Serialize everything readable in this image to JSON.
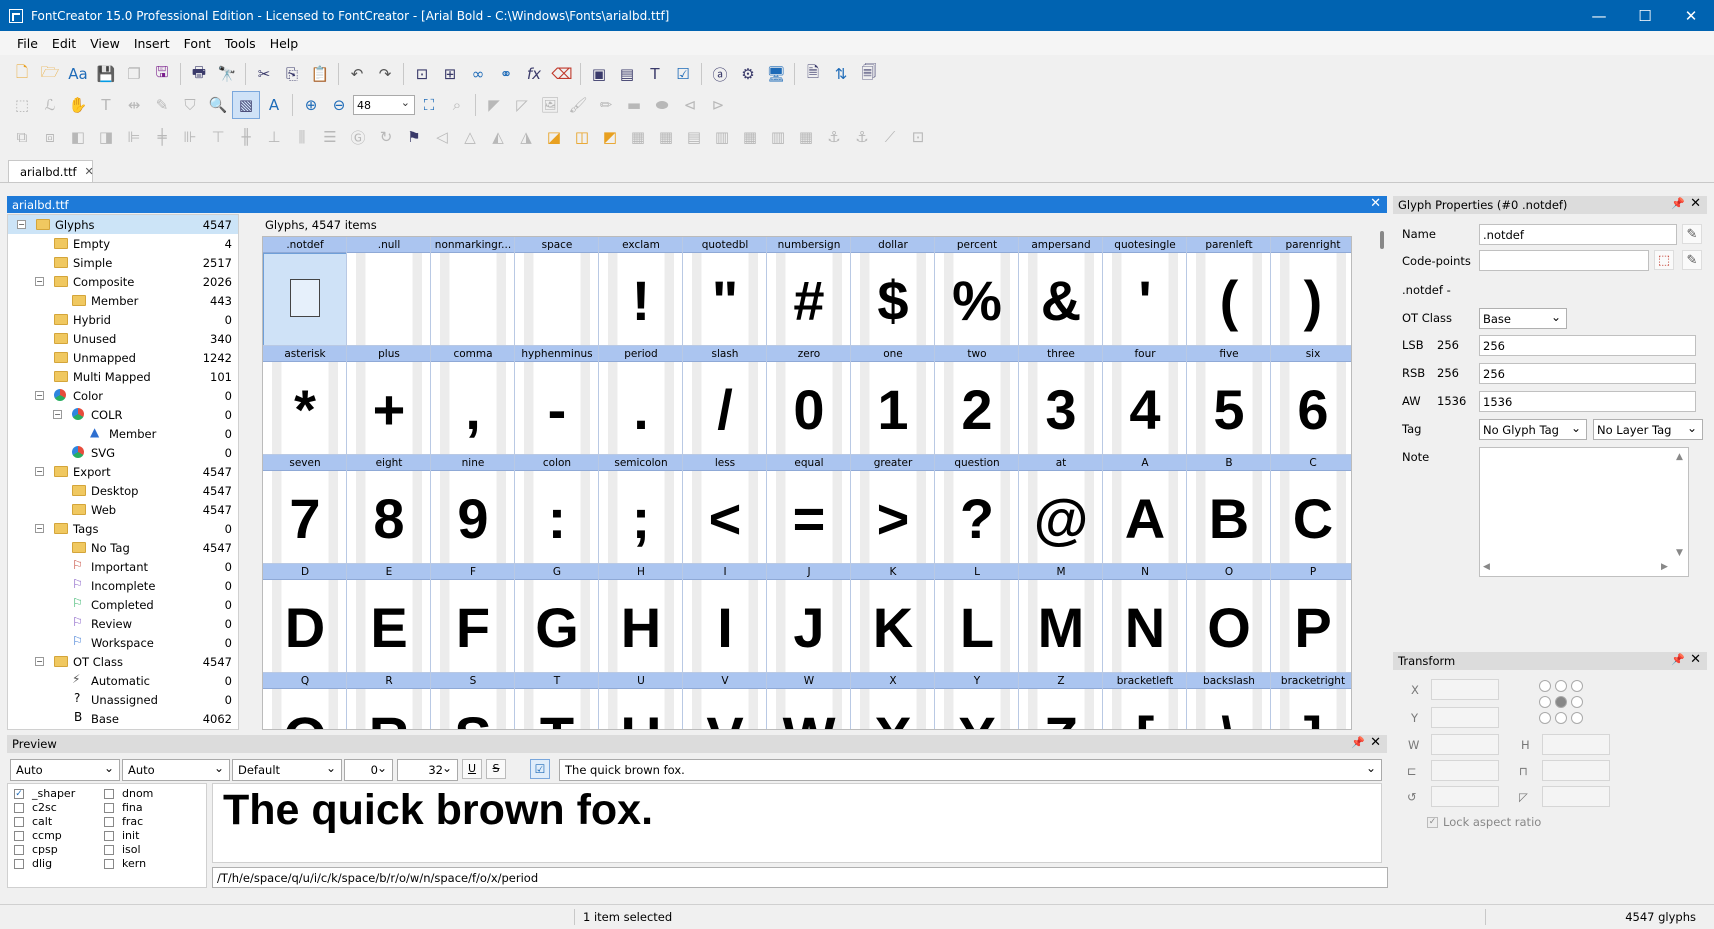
{
  "titlebar": {
    "title": "FontCreator 15.0 Professional Edition - Licensed to FontCreator - [Arial Bold - C:\\Windows\\Fonts\\arialbd.ttf]",
    "minimize": "—",
    "maximize": "☐",
    "close": "✕"
  },
  "menu": [
    "File",
    "Edit",
    "View",
    "Insert",
    "Font",
    "Tools",
    "Help"
  ],
  "toolbar": {
    "zoom_value": "48"
  },
  "doc_tab": {
    "label": "arialbd.ttf",
    "close": "✕"
  },
  "doc_panel": {
    "title": "arialbd.ttf",
    "close": "✕"
  },
  "tree": [
    {
      "label": "Glyphs",
      "count": "4547",
      "level": 0,
      "toggle": "−",
      "icon": "folder",
      "selected": true
    },
    {
      "label": "Empty",
      "count": "4",
      "level": 1,
      "icon": "folder"
    },
    {
      "label": "Simple",
      "count": "2517",
      "level": 1,
      "icon": "folder"
    },
    {
      "label": "Composite",
      "count": "2026",
      "level": 1,
      "toggle": "−",
      "icon": "folder"
    },
    {
      "label": "Member",
      "count": "443",
      "level": 2,
      "icon": "folder"
    },
    {
      "label": "Hybrid",
      "count": "0",
      "level": 1,
      "icon": "folder"
    },
    {
      "label": "Unused",
      "count": "340",
      "level": 1,
      "icon": "folder"
    },
    {
      "label": "Unmapped",
      "count": "1242",
      "level": 1,
      "icon": "folder"
    },
    {
      "label": "Multi Mapped",
      "count": "101",
      "level": 1,
      "icon": "folder"
    },
    {
      "label": "Color",
      "count": "0",
      "level": 1,
      "toggle": "−",
      "icon": "color"
    },
    {
      "label": "COLR",
      "count": "0",
      "level": 2,
      "toggle": "−",
      "icon": "color"
    },
    {
      "label": "Member",
      "count": "0",
      "level": 3,
      "icon": "triangle"
    },
    {
      "label": "SVG",
      "count": "0",
      "level": 2,
      "icon": "color"
    },
    {
      "label": "Export",
      "count": "4547",
      "level": 1,
      "toggle": "−",
      "icon": "folder"
    },
    {
      "label": "Desktop",
      "count": "4547",
      "level": 2,
      "icon": "folder"
    },
    {
      "label": "Web",
      "count": "4547",
      "level": 2,
      "icon": "folder"
    },
    {
      "label": "Tags",
      "count": "0",
      "level": 1,
      "toggle": "−",
      "icon": "folder"
    },
    {
      "label": "No Tag",
      "count": "4547",
      "level": 2,
      "icon": "folder"
    },
    {
      "label": "Important",
      "count": "0",
      "level": 2,
      "icon": "flag-red"
    },
    {
      "label": "Incomplete",
      "count": "0",
      "level": 2,
      "icon": "flag-purple"
    },
    {
      "label": "Completed",
      "count": "0",
      "level": 2,
      "icon": "flag-green"
    },
    {
      "label": "Review",
      "count": "0",
      "level": 2,
      "icon": "flag-purple"
    },
    {
      "label": "Workspace",
      "count": "0",
      "level": 2,
      "icon": "flag-blue"
    },
    {
      "label": "OT Class",
      "count": "4547",
      "level": 1,
      "toggle": "−",
      "icon": "folder"
    },
    {
      "label": "Automatic",
      "count": "0",
      "level": 2,
      "icon": "bolt"
    },
    {
      "label": "Unassigned",
      "count": "0",
      "level": 2,
      "icon": "question"
    },
    {
      "label": "Base",
      "count": "4062",
      "level": 2,
      "icon": "letter-b"
    }
  ],
  "glyph_grid": {
    "header": "Glyphs, 4547 items",
    "glyphs": [
      {
        "name": ".notdef",
        "char": ""
      },
      {
        "name": ".null",
        "char": ""
      },
      {
        "name": "nonmarkingr...",
        "char": ""
      },
      {
        "name": "space",
        "char": ""
      },
      {
        "name": "exclam",
        "char": "!"
      },
      {
        "name": "quotedbl",
        "char": "\""
      },
      {
        "name": "numbersign",
        "char": "#"
      },
      {
        "name": "dollar",
        "char": "$"
      },
      {
        "name": "percent",
        "char": "%"
      },
      {
        "name": "ampersand",
        "char": "&"
      },
      {
        "name": "quotesingle",
        "char": "'"
      },
      {
        "name": "parenleft",
        "char": "("
      },
      {
        "name": "parenright",
        "char": ")"
      },
      {
        "name": "asterisk",
        "char": "*"
      },
      {
        "name": "plus",
        "char": "+"
      },
      {
        "name": "comma",
        "char": ","
      },
      {
        "name": "hyphenminus",
        "char": "-"
      },
      {
        "name": "period",
        "char": "."
      },
      {
        "name": "slash",
        "char": "/"
      },
      {
        "name": "zero",
        "char": "0"
      },
      {
        "name": "one",
        "char": "1"
      },
      {
        "name": "two",
        "char": "2"
      },
      {
        "name": "three",
        "char": "3"
      },
      {
        "name": "four",
        "char": "4"
      },
      {
        "name": "five",
        "char": "5"
      },
      {
        "name": "six",
        "char": "6"
      },
      {
        "name": "seven",
        "char": "7"
      },
      {
        "name": "eight",
        "char": "8"
      },
      {
        "name": "nine",
        "char": "9"
      },
      {
        "name": "colon",
        "char": ":"
      },
      {
        "name": "semicolon",
        "char": ";"
      },
      {
        "name": "less",
        "char": "<"
      },
      {
        "name": "equal",
        "char": "="
      },
      {
        "name": "greater",
        "char": ">"
      },
      {
        "name": "question",
        "char": "?"
      },
      {
        "name": "at",
        "char": "@"
      },
      {
        "name": "A",
        "char": "A"
      },
      {
        "name": "B",
        "char": "B"
      },
      {
        "name": "C",
        "char": "C"
      },
      {
        "name": "D",
        "char": "D"
      },
      {
        "name": "E",
        "char": "E"
      },
      {
        "name": "F",
        "char": "F"
      },
      {
        "name": "G",
        "char": "G"
      },
      {
        "name": "H",
        "char": "H"
      },
      {
        "name": "I",
        "char": "I"
      },
      {
        "name": "J",
        "char": "J"
      },
      {
        "name": "K",
        "char": "K"
      },
      {
        "name": "L",
        "char": "L"
      },
      {
        "name": "M",
        "char": "M"
      },
      {
        "name": "N",
        "char": "N"
      },
      {
        "name": "O",
        "char": "O"
      },
      {
        "name": "P",
        "char": "P"
      },
      {
        "name": "Q",
        "char": "Q"
      },
      {
        "name": "R",
        "char": "R"
      },
      {
        "name": "S",
        "char": "S"
      },
      {
        "name": "T",
        "char": "T"
      },
      {
        "name": "U",
        "char": "U"
      },
      {
        "name": "V",
        "char": "V"
      },
      {
        "name": "W",
        "char": "W"
      },
      {
        "name": "X",
        "char": "X"
      },
      {
        "name": "Y",
        "char": "Y"
      },
      {
        "name": "Z",
        "char": "Z"
      },
      {
        "name": "bracketleft",
        "char": "["
      },
      {
        "name": "backslash",
        "char": "\\"
      },
      {
        "name": "bracketright",
        "char": "]"
      }
    ]
  },
  "glyph_properties": {
    "title": "Glyph Properties (#0 .notdef)",
    "name_label": "Name",
    "name_value": ".notdef",
    "codepoints_label": "Code-points",
    "codepoints_value": "",
    "desc": ".notdef -",
    "otclass_label": "OT Class",
    "otclass_value": "Base",
    "lsb_label": "LSB",
    "lsb_num": "256",
    "lsb_value": "256",
    "rsb_label": "RSB",
    "rsb_num": "256",
    "rsb_value": "256",
    "aw_label": "AW",
    "aw_num": "1536",
    "aw_value": "1536",
    "tag_label": "Tag",
    "tag_value": "No Glyph Tag",
    "layer_tag_value": "No Layer Tag",
    "note_label": "Note"
  },
  "transform": {
    "title": "Transform",
    "x_label": "X",
    "y_label": "Y",
    "w_label": "W",
    "h_label": "H",
    "lock_label": "Lock aspect ratio"
  },
  "preview": {
    "title": "Preview",
    "script": "Auto",
    "language": "Auto",
    "profile": "Default",
    "spin1": "0",
    "spin2": "32",
    "text_input": "The quick brown fox.",
    "features": [
      {
        "label": "_shaper",
        "checked": true
      },
      {
        "label": "c2sc",
        "checked": false
      },
      {
        "label": "calt",
        "checked": false
      },
      {
        "label": "ccmp",
        "checked": false
      },
      {
        "label": "cpsp",
        "checked": false
      },
      {
        "label": "dlig",
        "checked": false
      },
      {
        "label": "dnom",
        "checked": false
      },
      {
        "label": "fina",
        "checked": false
      },
      {
        "label": "frac",
        "checked": false
      },
      {
        "label": "init",
        "checked": false
      },
      {
        "label": "isol",
        "checked": false
      },
      {
        "label": "kern",
        "checked": false
      }
    ],
    "rendered_text": "The quick brown fox.",
    "glyph_path": "/T/h/e/space/q/u/i/c/k/space/b/r/o/w/n/space/f/o/x/period"
  },
  "statusbar": {
    "selection": "1 item selected",
    "glyph_count": "4547 glyphs"
  }
}
